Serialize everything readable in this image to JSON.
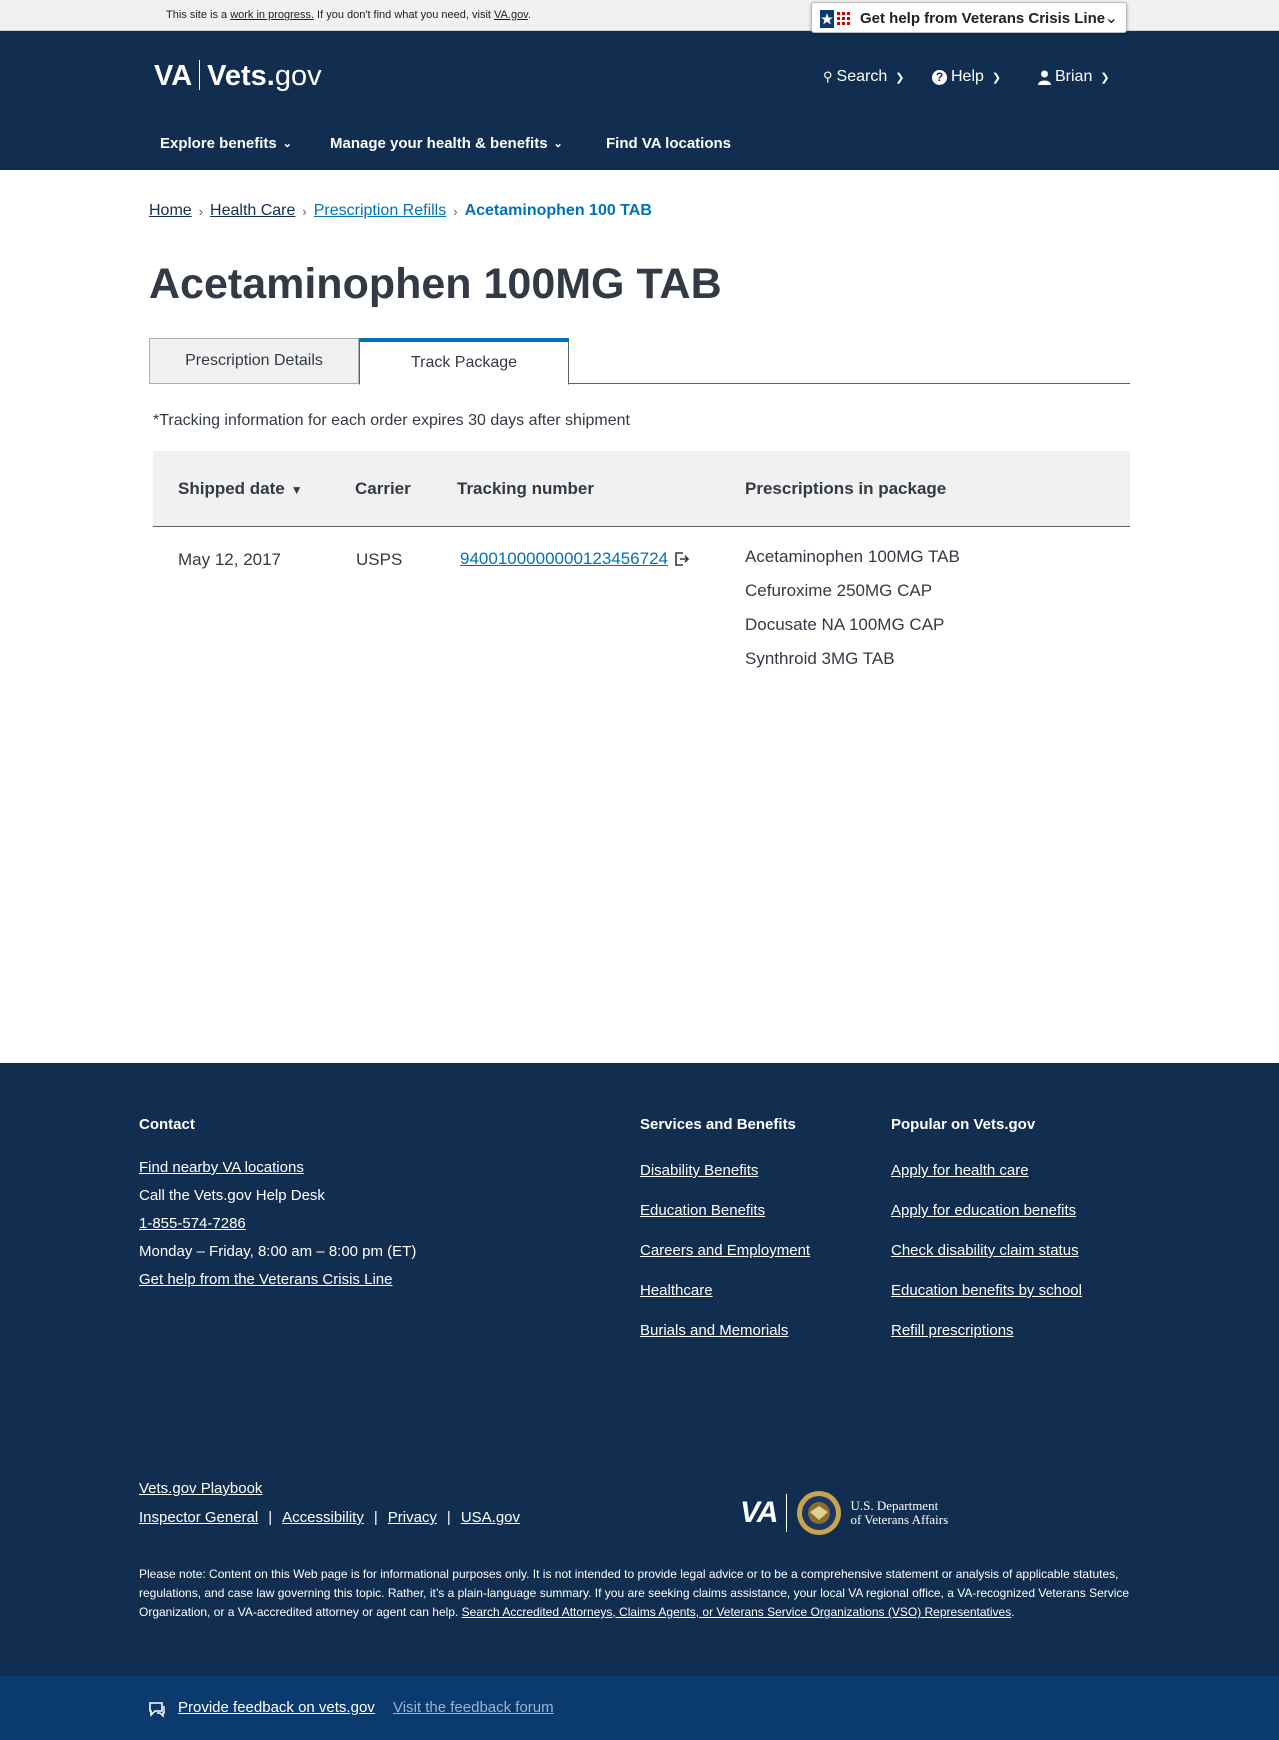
{
  "banner": {
    "wip_prefix": "This site is a",
    "wip_link": "work in progress.",
    "wip_middle": "If you don't find what you need, visit",
    "wip_va_link": "VA.gov",
    "wip_suffix": ".",
    "crisis_label": "Get help from Veterans Crisis Line"
  },
  "header": {
    "logo_va": "VA",
    "logo_vets": "Vets.",
    "logo_gov": "gov",
    "search_label": "Search",
    "help_label": "Help",
    "user_label": "Brian",
    "nav": {
      "explore": "Explore benefits",
      "manage": "Manage your health & benefits",
      "find": "Find VA locations"
    }
  },
  "breadcrumb": {
    "home": "Home",
    "health_care": "Health Care",
    "prescription_refills": "Prescription Refills",
    "current": "Acetaminophen 100 TAB"
  },
  "page": {
    "title": "Acetaminophen 100MG TAB",
    "tabs": {
      "details": "Prescription Details",
      "track": "Track Package"
    },
    "note": "*Tracking information for each order expires 30 days after shipment"
  },
  "table": {
    "headers": {
      "shipped_date": "Shipped date",
      "carrier": "Carrier",
      "tracking_number": "Tracking number",
      "prescriptions": "Prescriptions in package"
    },
    "row": {
      "shipped_date": "May 12, 2017",
      "carrier": "USPS",
      "tracking_number": "9400100000000123456724",
      "prescriptions": [
        "Acetaminophen 100MG TAB",
        "Cefuroxime 250MG CAP",
        "Docusate NA 100MG CAP",
        "Synthroid 3MG TAB"
      ]
    }
  },
  "footer": {
    "contact_heading": "Contact",
    "contact": {
      "find_locations": "Find nearby VA locations",
      "call_help_desk": "Call the Vets.gov Help Desk",
      "phone": "1-855-574-7286",
      "hours": "Monday – Friday, 8:00 am – 8:00 pm (ET)",
      "crisis_line": "Get help from the Veterans Crisis Line"
    },
    "services_heading": "Services and Benefits",
    "services": [
      "Disability Benefits",
      "Education Benefits",
      "Careers and Employment",
      "Healthcare",
      "Burials and Memorials"
    ],
    "popular_heading": "Popular on Vets.gov",
    "popular": [
      "Apply for health care",
      "Apply for education benefits",
      "Check disability claim status",
      "Education benefits by school",
      "Refill prescriptions"
    ],
    "playbook": "Vets.gov Playbook",
    "links": {
      "inspector_general": "Inspector General",
      "accessibility": "Accessibility",
      "privacy": "Privacy",
      "usa_gov": "USA.gov",
      "pipe": "|"
    },
    "logo_va": "VA",
    "dept_line1": "U.S. Department",
    "dept_line2": "of Veterans Affairs",
    "disclaimer": "Please note: Content on this Web page is for informational purposes only. It is not intended to provide legal advice or to be a comprehensive statement or analysis of applicable statutes, regulations, and case law governing this topic. Rather, it’s a plain-language summary. If you are seeking claims assistance, your local VA regional office, a VA-recognized Veterans Service Organization, or a VA-accredited attorney or agent can help.",
    "disclaimer_link": "Search Accredited Attorneys, Claims Agents, or Veterans Service Organizations (VSO) Representatives",
    "disclaimer_end": "."
  },
  "feedback": {
    "provide": "Provide feedback on vets.gov",
    "visit": "Visit the feedback forum"
  },
  "colors": {
    "header_bg": "#112e51",
    "link_blue": "#0071bb",
    "feedback_bg": "#0a3a6e"
  }
}
